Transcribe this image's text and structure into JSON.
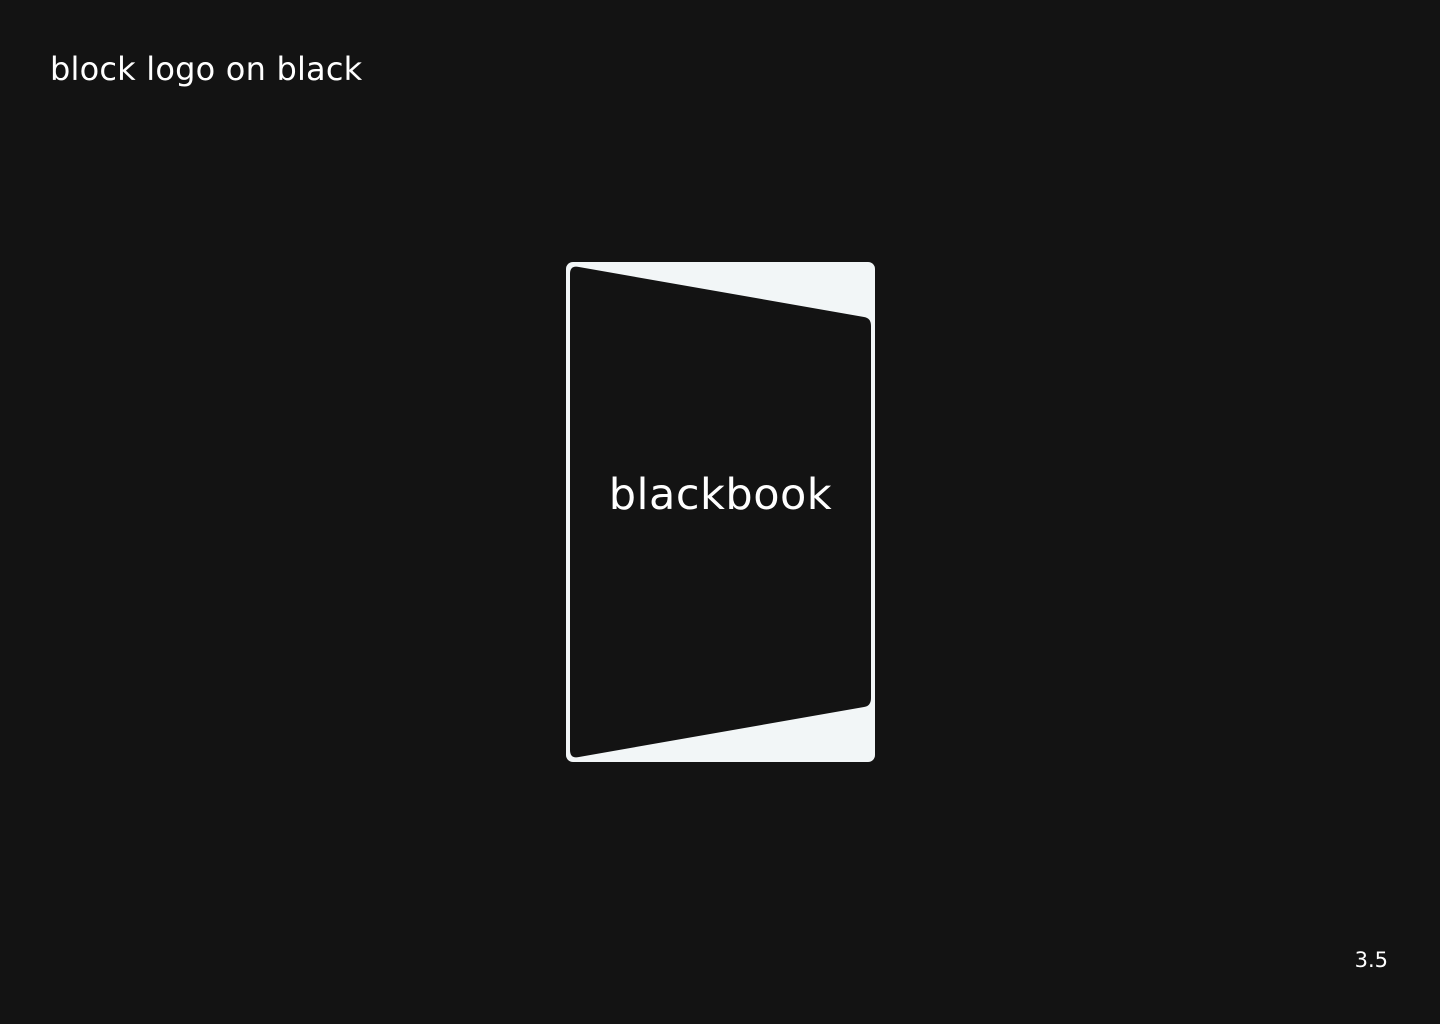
{
  "page": {
    "title": "block logo on black",
    "number": "3.5"
  },
  "logo": {
    "wordmark": "blackbook",
    "icon": "book-block-logo-icon",
    "frame_color": "#f2f6f7",
    "fill_color": "#131313"
  },
  "colors": {
    "background": "#131313",
    "text": "#ffffff"
  }
}
